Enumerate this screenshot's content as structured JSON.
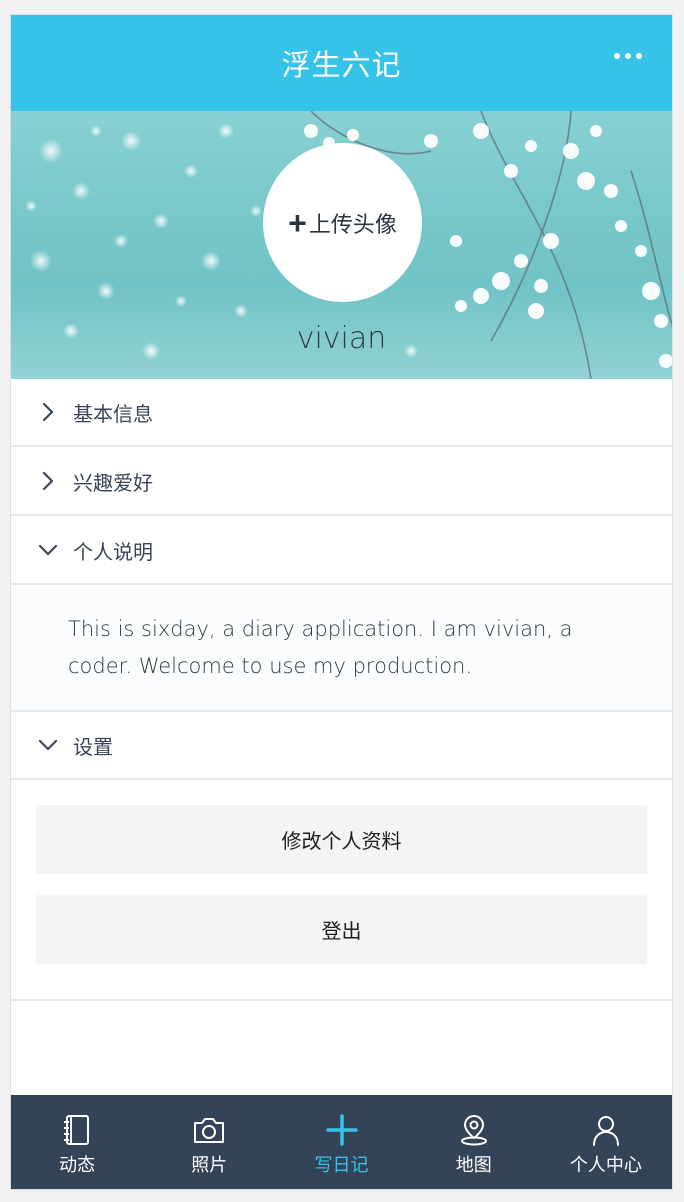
{
  "header": {
    "title": "浮生六记",
    "more_icon": "more-dots-icon"
  },
  "profile": {
    "avatar_plus": "+",
    "avatar_label": "上传头像",
    "username": "vivian"
  },
  "sections": {
    "basic_info": "基本信息",
    "hobbies": "兴趣爱好",
    "description": "个人说明",
    "settings": "设置"
  },
  "description_text": "This is sixday, a diary application. I am vivian, a coder. Welcome to use my production.",
  "buttons": {
    "edit_profile": "修改个人资料",
    "logout": "登出"
  },
  "tabbar": {
    "tabs": [
      {
        "label": "动态",
        "icon": "notebook-icon"
      },
      {
        "label": "照片",
        "icon": "camera-icon"
      },
      {
        "label": "写日记",
        "icon": "plus-icon"
      },
      {
        "label": "地图",
        "icon": "map-pin-icon"
      },
      {
        "label": "个人中心",
        "icon": "user-icon"
      }
    ],
    "active_index": 2
  },
  "colors": {
    "accent": "#35c3e8",
    "tabbar_bg": "#334358"
  }
}
